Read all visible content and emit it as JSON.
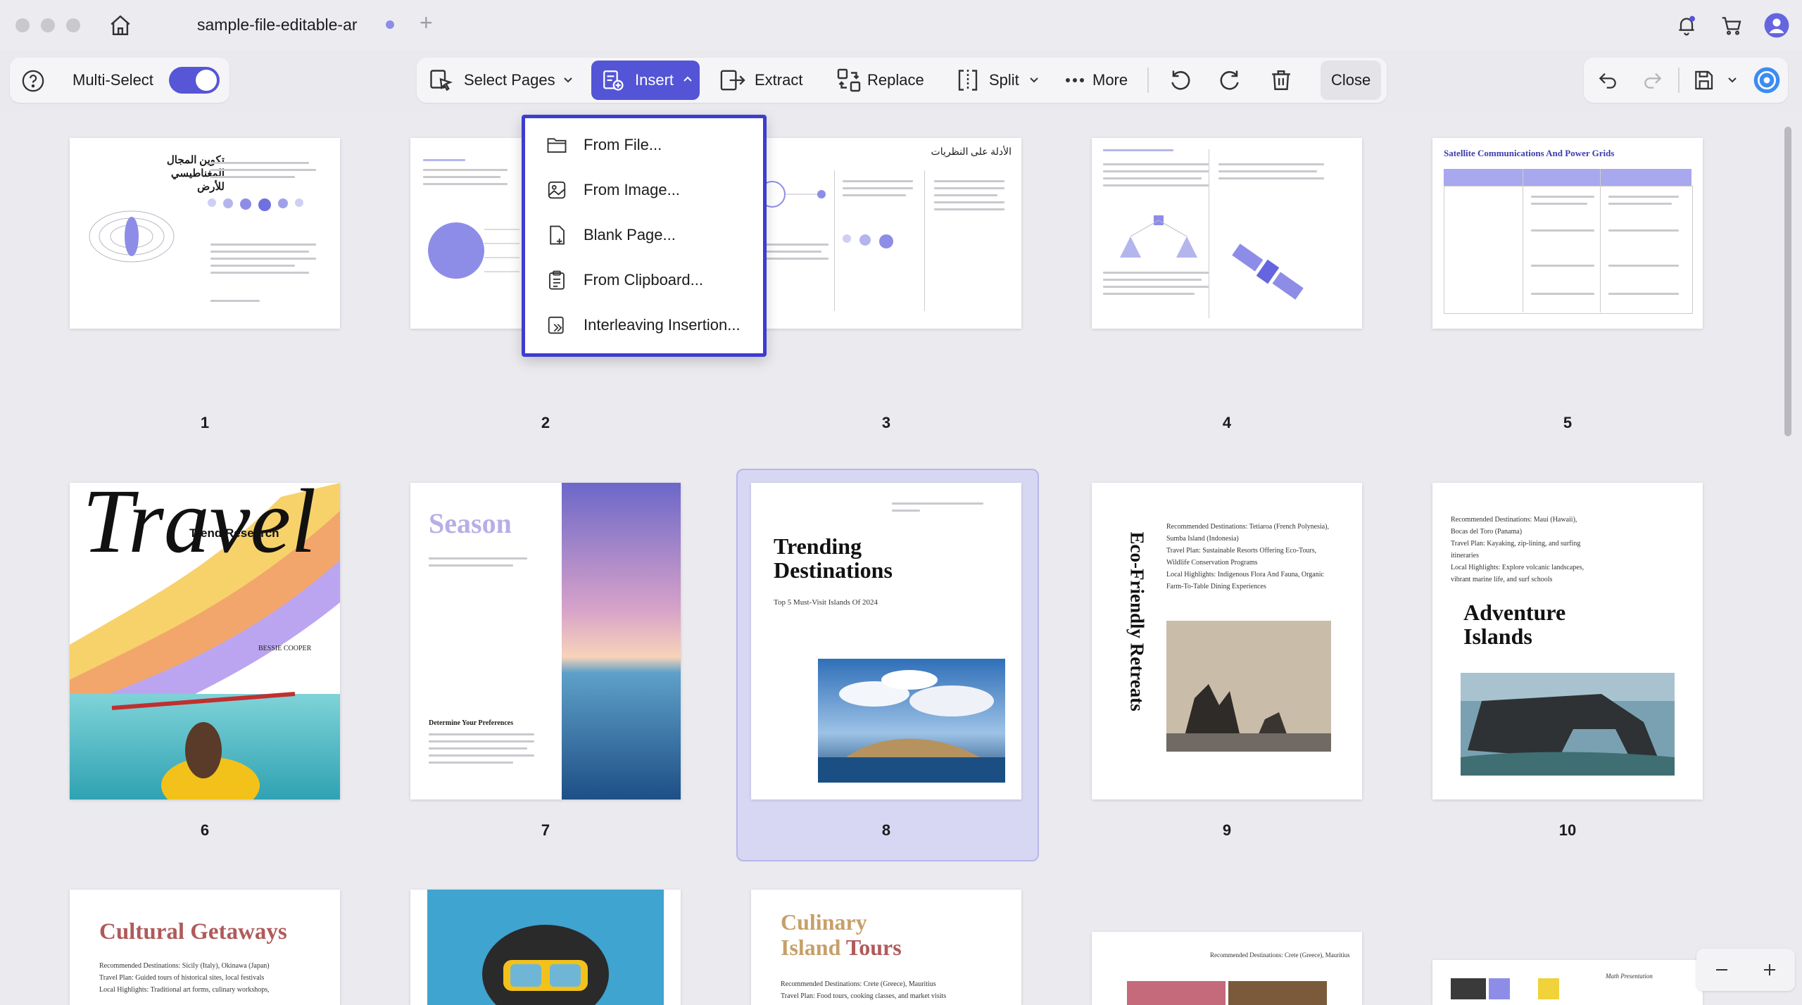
{
  "titlebar": {
    "tab_title": "sample-file-editable-ar"
  },
  "toolbar": {
    "multi_select_label": "Multi-Select",
    "select_pages_label": "Select Pages",
    "insert_label": "Insert",
    "extract_label": "Extract",
    "replace_label": "Replace",
    "split_label": "Split",
    "more_label": "More",
    "close_label": "Close"
  },
  "insert_menu": {
    "items": [
      {
        "label": "From File...",
        "icon": "folder-icon"
      },
      {
        "label": "From Image...",
        "icon": "image-icon"
      },
      {
        "label": "Blank Page...",
        "icon": "blank-page-icon"
      },
      {
        "label": "From Clipboard...",
        "icon": "clipboard-icon"
      },
      {
        "label": "Interleaving Insertion...",
        "icon": "interleave-icon"
      }
    ]
  },
  "pages": [
    {
      "number": "1",
      "title": "تكوين المجال المغناطيسي للأرض"
    },
    {
      "number": "2"
    },
    {
      "number": "3",
      "title": "الأدلة على النظريات"
    },
    {
      "number": "4"
    },
    {
      "number": "5",
      "title": "Satellite Communications And Power Grids"
    },
    {
      "number": "6",
      "title": "Travel",
      "subtitle": "Trend Research",
      "author": "BESSIE COOPER"
    },
    {
      "number": "7",
      "title": "Season",
      "subtitle": "Determine Your Preferences"
    },
    {
      "number": "8",
      "title_line1": "Trending",
      "title_line2": "Destinations",
      "subtitle": "Top 5 Must-Visit Islands Of 2024",
      "selected": true
    },
    {
      "number": "9",
      "title": "Eco-Friendly Retreats",
      "text_lines": [
        "Recommended Destinations: Tetiaroa (French Polynesia),",
        "Sumba Island (Indonesia)",
        "Travel Plan: Sustainable Resorts Offering Eco-Tours,",
        "Wildlife Conservation Programs",
        "Local Highlights: Indigenous Flora And Fauna, Organic",
        "Farm-To-Table Dining Experiences"
      ]
    },
    {
      "number": "10",
      "title_line1": "Adventure",
      "title_line2": "Islands",
      "text_lines": [
        "Recommended Destinations: Maui (Hawaii),",
        "Bocas del Toro (Panama)",
        "Travel Plan: Kayaking, zip-lining, and surfing",
        "itineraries",
        "Local Highlights: Explore volcanic landscapes,",
        "vibrant marine life, and surf schools"
      ]
    },
    {
      "title": "Cultural Getaways",
      "text_lines": [
        "Recommended Destinations: Sicily (Italy), Okinawa (Japan)",
        "Travel Plan: Guided tours of historical sites, local festivals",
        "Local Highlights: Traditional art forms, culinary workshops,"
      ]
    },
    {
      "title": ""
    },
    {
      "title_line1": "Culinary",
      "title_line2_a": "Island",
      "title_line2_b": "Tours",
      "text_lines": [
        "Recommended Destinations: Crete (Greece), Mauritius",
        "Travel Plan: Food tours, cooking classes, and market visits"
      ]
    },
    {
      "text_lines": [
        "Recommended Destinations: Crete (Greece), Mauritius"
      ]
    },
    {
      "title": "Math Presentation"
    }
  ],
  "colors": {
    "accent": "#5454d6",
    "menu_border": "#3d3dcf",
    "selection": "#d7d7f3"
  }
}
